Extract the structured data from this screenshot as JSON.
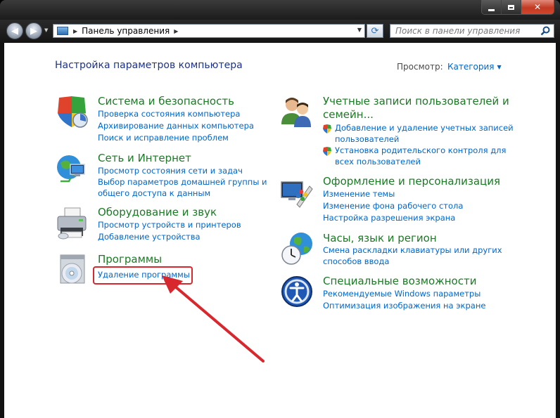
{
  "window": {
    "min_label": "",
    "max_label": "",
    "close_label": "✕"
  },
  "address": {
    "path": "Панель управления",
    "search_placeholder": "Поиск в панели управления"
  },
  "header": {
    "title": "Настройка параметров компьютера",
    "view_label": "Просмотр:",
    "view_value": "Категория"
  },
  "categories_left": [
    {
      "title": "Система и безопасность",
      "links": [
        "Проверка состояния компьютера",
        "Архивирование данных компьютера",
        "Поиск и исправление проблем"
      ]
    },
    {
      "title": "Сеть и Интернет",
      "links": [
        "Просмотр состояния сети и задач",
        "Выбор параметров домашней группы и",
        "общего доступа к данным"
      ]
    },
    {
      "title": "Оборудование и звук",
      "links": [
        "Просмотр устройств и принтеров",
        "Добавление устройства"
      ]
    },
    {
      "title": "Программы",
      "links": [
        "Удаление программы"
      ]
    }
  ],
  "categories_right": [
    {
      "title_line1": "Учетные записи пользователей и",
      "title_line2": "семейн...",
      "links": [
        "Добавление и удаление учетных записей",
        "пользователей",
        "Установка родительского контроля для",
        "всех пользователей"
      ]
    },
    {
      "title": "Оформление и персонализация",
      "links": [
        "Изменение темы",
        "Изменение фона рабочего стола",
        "Настройка разрешения экрана"
      ]
    },
    {
      "title": "Часы, язык и регион",
      "links": [
        "Смена раскладки клавиатуры или других",
        "способов ввода"
      ]
    },
    {
      "title": "Специальные возможности",
      "links": [
        "Рекомендуемые Windows параметры",
        "Оптимизация изображения на экране"
      ]
    }
  ],
  "colors": {
    "title_green": "#1a7a24",
    "link_blue": "#0066cc",
    "heading_blue": "#1e3287",
    "annotation_red": "#d8282e"
  },
  "icons": [
    "shield-icon",
    "network-globe-icon",
    "printer-icon",
    "programs-disc-icon",
    "users-icon",
    "personalization-monitor-icon",
    "clock-globe-icon",
    "accessibility-icon",
    "search-icon",
    "refresh-icon"
  ]
}
